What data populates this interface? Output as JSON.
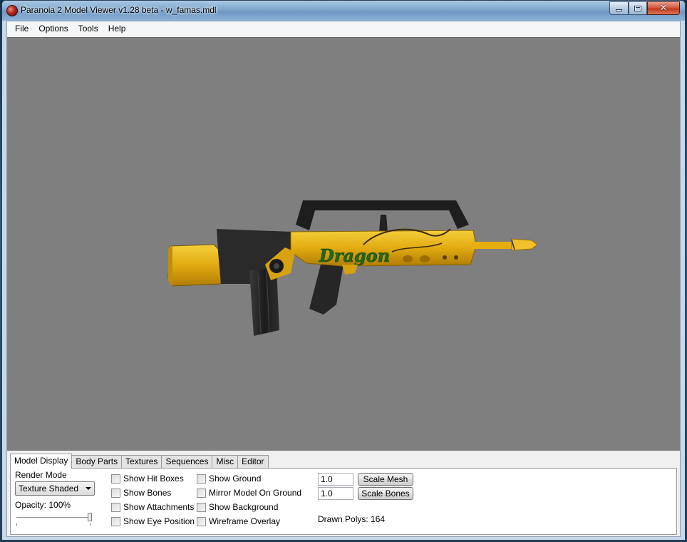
{
  "window": {
    "title": "Paranoia 2 Model Viewer v1.28 beta - w_famas.mdl",
    "min_glyph": "",
    "close_glyph": "✕"
  },
  "menu": [
    "File",
    "Options",
    "Tools",
    "Help"
  ],
  "viewport": {
    "background": "#7f7f7f",
    "model_text": "Dragon",
    "model_colors": {
      "gold": "#e8b417",
      "dark": "#1f1f1f",
      "engraving": "#1f6a1f"
    }
  },
  "tabs": [
    "Model Display",
    "Body Parts",
    "Textures",
    "Sequences",
    "Misc",
    "Editor"
  ],
  "active_tab": "Model Display",
  "model_display": {
    "render_mode_label": "Render Mode",
    "render_mode_value": "Texture Shaded",
    "opacity_label": "Opacity: 100%",
    "opacity_value": 1.0,
    "checks_col1": [
      "Show Hit Boxes",
      "Show Bones",
      "Show Attachments",
      "Show Eye Position"
    ],
    "checks_col2": [
      "Show Ground",
      "Mirror Model On Ground",
      "Show Background",
      "Wireframe Overlay"
    ],
    "scale_mesh_value": "1.0",
    "scale_mesh_label": "Scale Mesh",
    "scale_bones_value": "1.0",
    "scale_bones_label": "Scale Bones",
    "drawn_polys": "Drawn Polys: 164"
  }
}
